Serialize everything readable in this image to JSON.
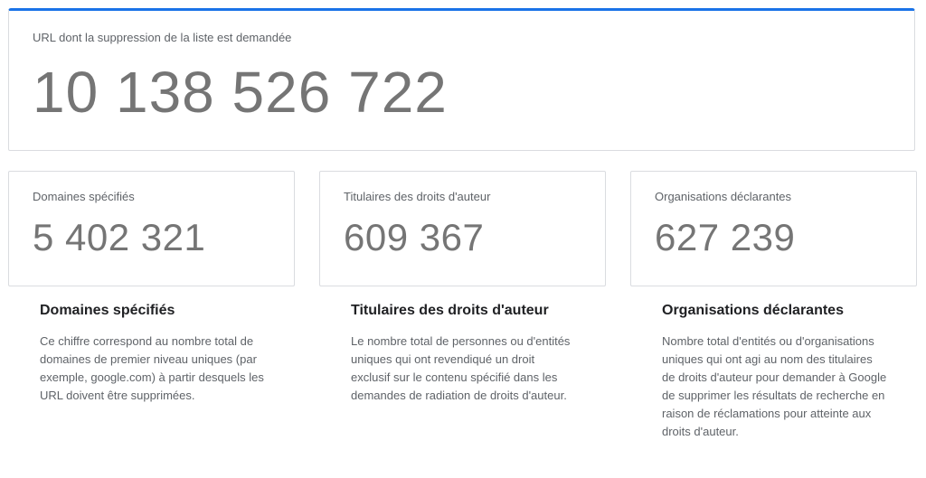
{
  "hero": {
    "label": "URL dont la suppression de la liste est demandée",
    "value": "10 138 526 722"
  },
  "stats": [
    {
      "label": "Domaines spécifiés",
      "value": "5 402 321"
    },
    {
      "label": "Titulaires des droits d'auteur",
      "value": "609 367"
    },
    {
      "label": "Organisations déclarantes",
      "value": "627 239"
    }
  ],
  "descriptions": [
    {
      "title": "Domaines spécifiés",
      "body": "Ce chiffre correspond au nombre total de domaines de premier niveau uniques (par exemple, google.com) à partir desquels les URL doivent être supprimées."
    },
    {
      "title": "Titulaires des droits d'auteur",
      "body": "Le nombre total de personnes ou d'entités uniques qui ont revendiqué un droit exclusif sur le contenu spécifié dans les demandes de radiation de droits d'auteur."
    },
    {
      "title": "Organisations déclarantes",
      "body": "Nombre total d'entités ou d'organisations uniques qui ont agi au nom des titulaires de droits d'auteur pour demander à Google de supprimer les résultats de recherche en raison de réclamations pour atteinte aux droits d'auteur."
    }
  ],
  "colors": {
    "accent": "#1a73e8",
    "value_text": "#757575",
    "card_border": "#dadce0"
  }
}
